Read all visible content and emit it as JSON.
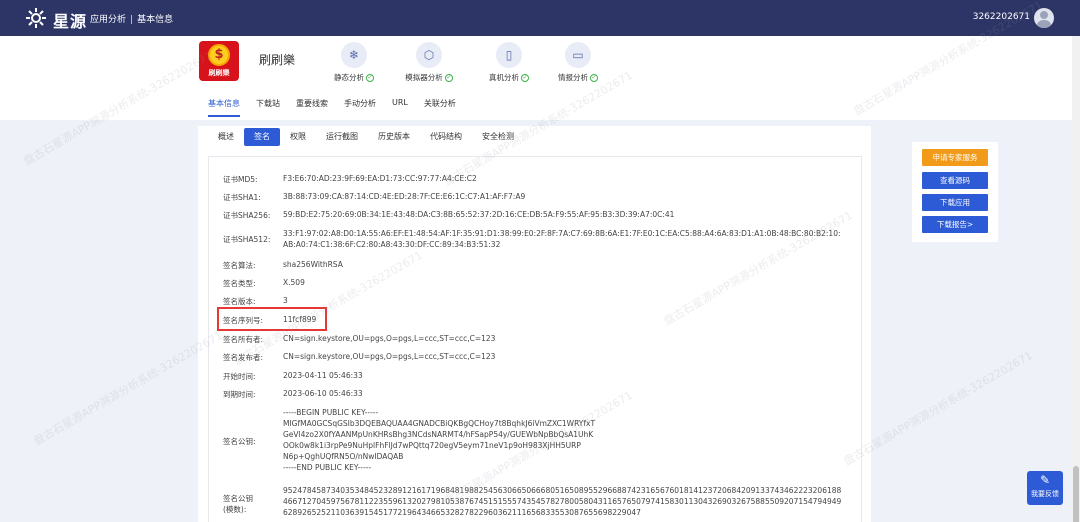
{
  "topbar": {
    "logo_text": "星源",
    "crumb_1": "应用分析",
    "crumb_sep": "|",
    "crumb_2": "基本信息",
    "user_id": "3262202671"
  },
  "app": {
    "name": "刷刷樂",
    "logo_caption": "刷刷樂",
    "logo_symbol": "$"
  },
  "features": [
    {
      "label": "静态分析",
      "icon": "snowflake-icon"
    },
    {
      "label": "模拟器分析",
      "icon": "box-icon"
    },
    {
      "label": "真机分析",
      "icon": "phone-icon"
    },
    {
      "label": "情报分析",
      "icon": "monitor-icon"
    }
  ],
  "nav_tabs": [
    "基本信息",
    "下载站",
    "重要线索",
    "手动分析",
    "URL",
    "关联分析"
  ],
  "sub_tabs": [
    "概述",
    "签名",
    "权限",
    "运行截图",
    "历史版本",
    "代码结构",
    "安全检测"
  ],
  "signature": {
    "md5_label": "证书MD5:",
    "md5": "F3:E6:70:AD:23:9F:69:EA:D1:73:CC:97:77:A4:CE:C2",
    "sha1_label": "证书SHA1:",
    "sha1": "3B:88:73:09:CA:87:14:CD:4E:ED:28:7F:CE:E6:1C:C7:A1:AF:F7:A9",
    "sha256_label": "证书SHA256:",
    "sha256": "59:BD:E2:75:20:69:0B:34:1E:43:48:DA:C3:8B:65:52:37:2D:16:CE:DB:5A:F9:55:AF:95:B3:3D:39:A7:0C:41",
    "sha512_label": "证书SHA512:",
    "sha512": "33:F1:97:02:A8:D0:1A:55:A6:EF:E1:48:54:AF:1F:35:91:D1:38:99:E0:2F:8F:7A:C7:69:8B:6A:E1:7F:E0:1C:EA:C5:88:A4:6A:83:D1:A1:0B:48:BC:80:B2:10:AB:A0:74:C1:38:6F:C2:80:A8:43:30:DF:CC:89:34:B3:51:32",
    "algo_label": "签名算法:",
    "algo": "sha256WithRSA",
    "type_label": "签名类型:",
    "type": "X.509",
    "version_label": "签名版本:",
    "version": "3",
    "serial_label": "签名序列号:",
    "serial": "11fcf899",
    "owner_label": "签名所有者:",
    "owner": "CN=sign.keystore,OU=pgs,O=pgs,L=ccc,ST=ccc,C=123",
    "issuer_label": "签名发布者:",
    "issuer": "CN=sign.keystore,OU=pgs,O=pgs,L=ccc,ST=ccc,C=123",
    "start_label": "开始时间:",
    "start": "2023-04-11 05:46:33",
    "end_label": "到期时间:",
    "end": "2023-06-10 05:46:33",
    "pubkey_label": "签名公钥:",
    "pubkey": "-----BEGIN PUBLIC KEY-----\nMIGfMA0GCSqGSIb3DQEBAQUAA4GNADCBiQKBgQCHoy7t8BqhkJ6iVmZXC1WRYfxT\nGeVl4zo2X0fYAANMpUnKHRsBhg3NCdsNARMT4/hFSapP54y/GUEWbNpBbQsA1UhK\nOOk0w8k1i3rpPe9NuHplFhFlJd7wPQttq720egV5eym71neV1p9oH983XjHH5URP\nN6p+QghUQfRN5O/nNwIDAQAB\n-----END PUBLIC KEY-----",
    "modulus_label_1": "签名公钥",
    "modulus_label_2": "(模数):",
    "modulus": "952478458734035348452328912161719684819882545630665066680516508955296688742316567601814123720684209133743462223206188466712704597567811223559613202798105387674515155574354578278005804311657650797415830113043269032675885509207154794949628926525211036391545177219643466532827822960362111656833553087655698229047"
  },
  "side_buttons": {
    "expert": "申请专家服务",
    "source": "查看源码",
    "download_app": "下载应用",
    "download_report": "下载报告>"
  },
  "feedback": {
    "label": "我要反馈"
  },
  "watermark_text": "盘古石星源APP溯源分析系统-3262202671",
  "colors": {
    "topbar": "#2c3566",
    "accent": "#2d5bd6",
    "orange": "#f29b1a",
    "highlight": "#e53935"
  }
}
